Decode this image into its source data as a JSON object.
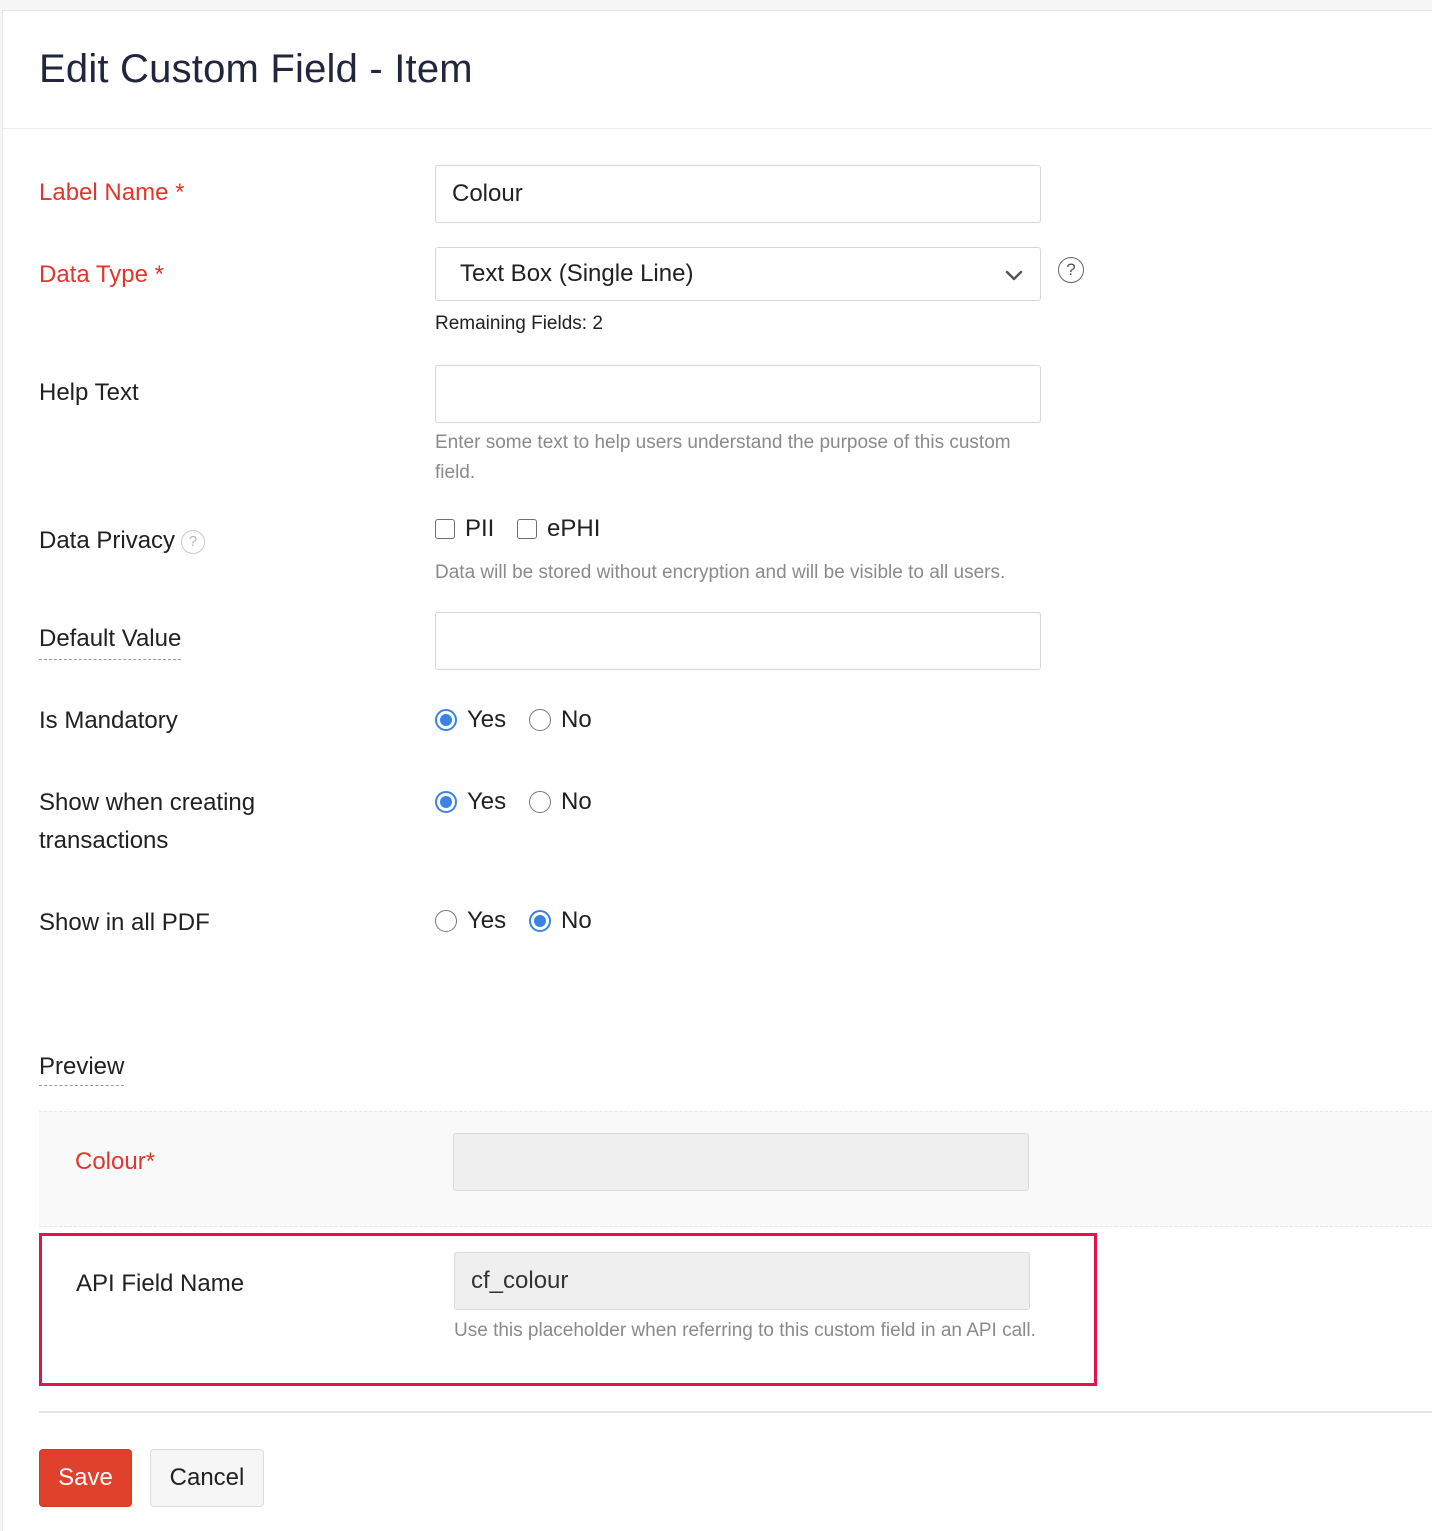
{
  "page": {
    "title": "Edit Custom Field - Item"
  },
  "fields": {
    "label_name": {
      "label": "Label Name *",
      "value": "Colour"
    },
    "data_type": {
      "label": "Data Type *",
      "value": "Text Box (Single Line)",
      "remaining": "Remaining Fields: 2",
      "help_glyph": "?"
    },
    "help_text": {
      "label": "Help Text",
      "value": "",
      "hint": "Enter some text to help users understand the purpose of this custom field."
    },
    "data_privacy": {
      "label": "Data Privacy",
      "help_glyph": "?",
      "options": [
        {
          "label": "PII",
          "checked": false
        },
        {
          "label": "ePHI",
          "checked": false
        }
      ],
      "hint": "Data will be stored without encryption and will be visible to all users."
    },
    "default_value": {
      "label": "Default Value",
      "value": ""
    },
    "is_mandatory": {
      "label": "Is Mandatory",
      "yes": "Yes",
      "no": "No",
      "selected": "Yes"
    },
    "show_creating": {
      "label": "Show when creating transactions",
      "yes": "Yes",
      "no": "No",
      "selected": "Yes"
    },
    "show_pdf": {
      "label": "Show in all PDF",
      "yes": "Yes",
      "no": "No",
      "selected": "No"
    }
  },
  "preview": {
    "label": "Preview",
    "field_label": "Colour*"
  },
  "api": {
    "label": "API Field Name",
    "value": "cf_colour",
    "hint": "Use this placeholder when referring to this custom field in an API call."
  },
  "buttons": {
    "save": "Save",
    "cancel": "Cancel"
  },
  "colors": {
    "required": "#e0362c",
    "accent": "#3b82e6",
    "highlight_border": "#e4124e",
    "save_button": "#e0412d"
  },
  "icons": {
    "dropdown": "chevron-down-icon",
    "help": "help-circle-icon"
  }
}
